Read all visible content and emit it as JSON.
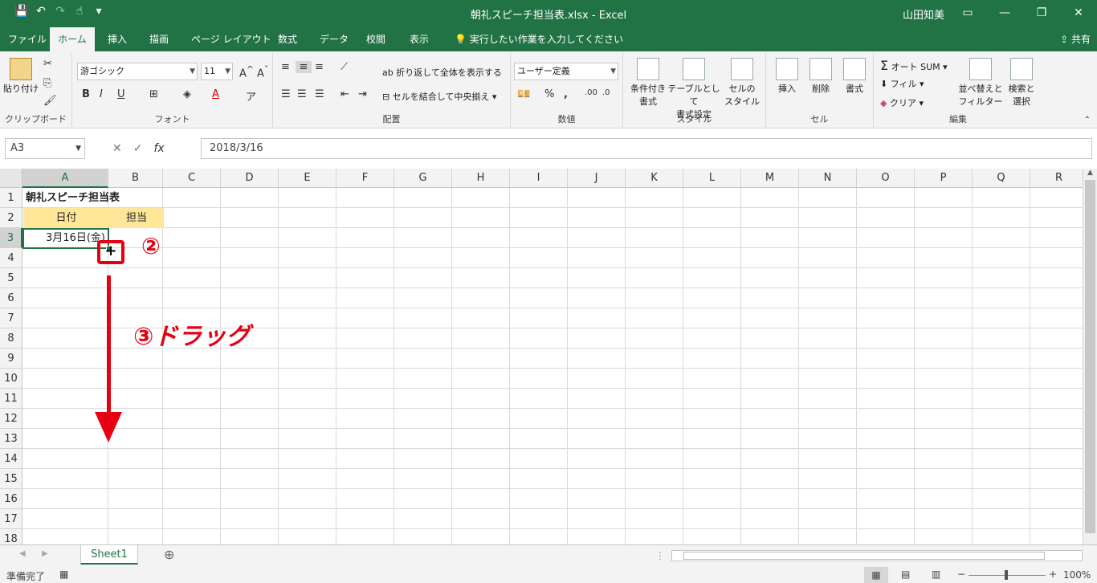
{
  "window": {
    "title": "朝礼スピーチ担当表.xlsx  -  Excel",
    "user": "山田知美",
    "share": "共有"
  },
  "qat": {
    "save": "💾",
    "undo": "↶",
    "redo": "↷",
    "touch": "☝",
    "more": "▾"
  },
  "menu": {
    "tabs": [
      "ファイル",
      "ホーム",
      "挿入",
      "描画",
      "ページ レイアウト",
      "数式",
      "データ",
      "校閲",
      "表示"
    ],
    "tellme": "実行したい作業を入力してください"
  },
  "ribbon": {
    "clipboard": {
      "paste": "貼り付け",
      "label": "クリップボード"
    },
    "font": {
      "name": "游ゴシック",
      "size": "11",
      "label": "フォント",
      "bold": "B",
      "italic": "I",
      "underline": "U"
    },
    "alignment": {
      "wrap": "折り返して全体を表示する",
      "merge": "セルを結合して中央揃え",
      "label": "配置"
    },
    "number": {
      "format": "ユーザー定義",
      "percent": "%",
      "comma": ",",
      "label": "数値"
    },
    "styles": {
      "cond": "条件付き\n書式",
      "table": "テーブルとして\n書式設定",
      "cell": "セルの\nスタイル",
      "label": "スタイル"
    },
    "cells": {
      "insert": "挿入",
      "delete": "削除",
      "format": "書式",
      "label": "セル"
    },
    "editing": {
      "autosum": "オート SUM",
      "fill": "フィル",
      "clear": "クリア",
      "sort": "並べ替えと\nフィルター",
      "find": "検索と\n選択",
      "label": "編集"
    }
  },
  "formula": {
    "namebox": "A3",
    "cancel": "✕",
    "enter": "✓",
    "fx": "fx",
    "value": "2018/3/16"
  },
  "grid": {
    "columns": [
      "A",
      "B",
      "C",
      "D",
      "E",
      "F",
      "G",
      "H",
      "I",
      "J",
      "K",
      "L",
      "M",
      "N",
      "O",
      "P",
      "Q",
      "R"
    ],
    "rows": [
      "1",
      "2",
      "3",
      "4",
      "5",
      "6",
      "7",
      "8",
      "9",
      "10",
      "11",
      "12",
      "13",
      "14",
      "15",
      "16",
      "17",
      "18"
    ],
    "a1": "朝礼スピーチ担当表",
    "a2": "日付",
    "b2": "担当",
    "a3": "3月16日(金)"
  },
  "annotations": {
    "step2": "②",
    "step3": "③ドラッグ",
    "cursor": "+"
  },
  "sheets": {
    "active": "Sheet1",
    "add": "⊕"
  },
  "status": {
    "ready": "準備完了",
    "zoom": "100%"
  }
}
